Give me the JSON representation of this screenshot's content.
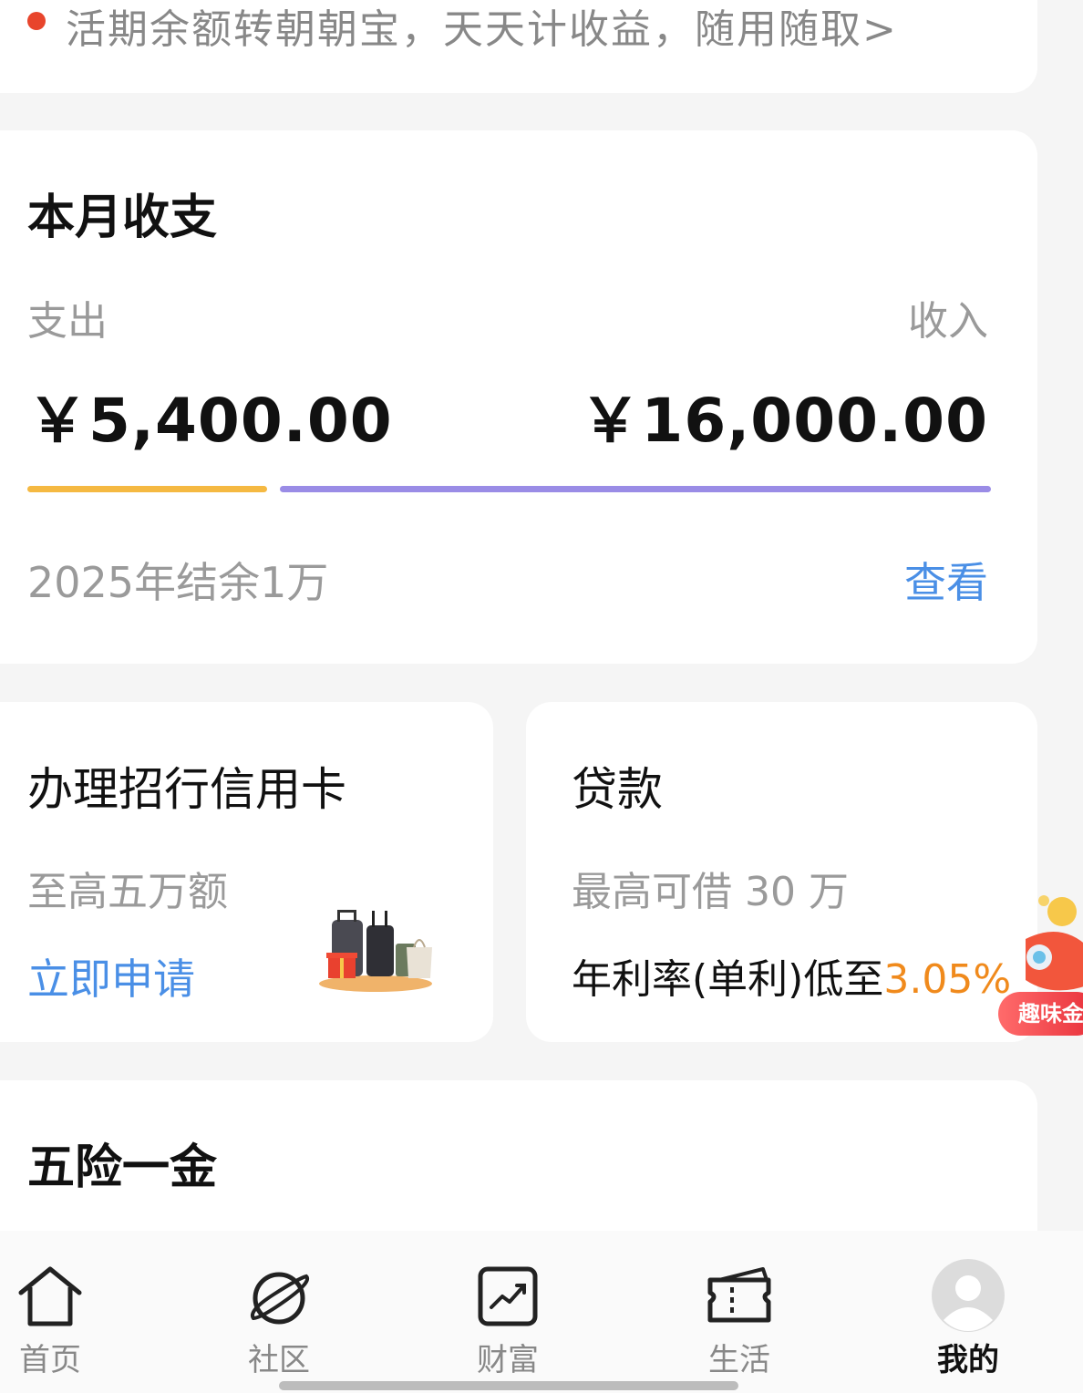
{
  "notice": {
    "text": "活期余额转朝朝宝，天天计收益，随用随取>"
  },
  "monthly": {
    "title": "本月收支",
    "expense_label": "支出",
    "income_label": "收入",
    "expense_amount": "￥5,400.00",
    "income_amount": "￥16,000.00",
    "expense_share": 0.2525,
    "expense_color": "#f5b942",
    "income_color": "#9a8ce6",
    "summary": "2025年结余1万",
    "view_link": "查看"
  },
  "credit_card": {
    "title": "办理招行信用卡",
    "subtitle": "至高五万额",
    "apply_link": "立即申请"
  },
  "loan": {
    "title": "贷款",
    "subtitle": "最高可借 30 万",
    "rate_prefix": "年利率(单利)低至",
    "rate_value": "3.05%"
  },
  "insurance": {
    "title": "五险一金"
  },
  "promo": {
    "label": "趣味金"
  },
  "tabs": [
    {
      "label": "首页",
      "icon": "home-icon"
    },
    {
      "label": "社区",
      "icon": "planet-icon"
    },
    {
      "label": "财富",
      "icon": "trend-chart-icon"
    },
    {
      "label": "生活",
      "icon": "ticket-icon"
    },
    {
      "label": "我的",
      "icon": "avatar-icon"
    }
  ],
  "colors": {
    "accent_blue": "#4a8fe6",
    "accent_orange": "#f08a1c",
    "alert_red": "#e8452c"
  }
}
